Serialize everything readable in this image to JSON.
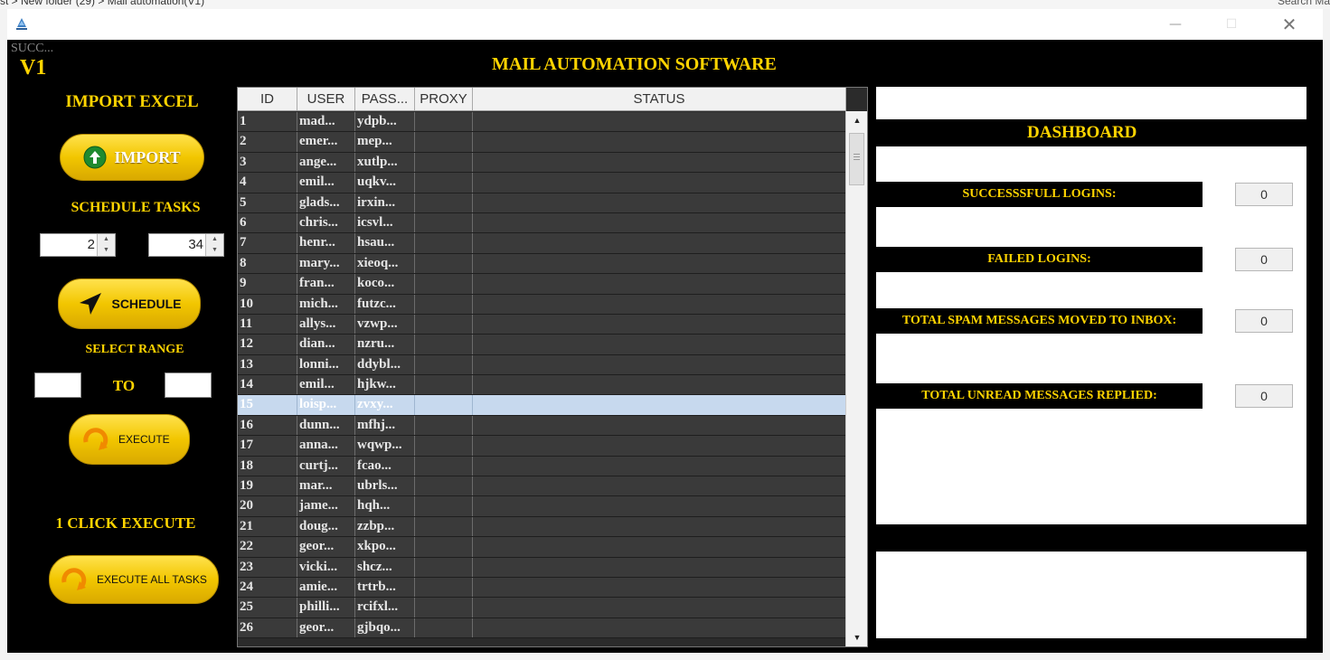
{
  "explorer": {
    "path": "st  >  New folder (29)  >  Mail automation(V1)",
    "search": "Search Ma"
  },
  "window": {
    "controls": {
      "minimize": "—",
      "maximize": "☐",
      "close": "✕"
    }
  },
  "app": {
    "status_text": "SUCC...",
    "version": "V1",
    "title": "MAIL AUTOMATION SOFTWARE"
  },
  "left_panel": {
    "import_heading": "IMPORT EXCEL",
    "import_button": "IMPORT",
    "schedule_heading": "SCHEDULE TASKS",
    "hour_value": "2",
    "minute_value": "34",
    "schedule_button": "SCHEDULE",
    "range_heading": "SELECT RANGE",
    "range_from": "",
    "range_to_label": "TO",
    "range_to": "",
    "execute_button": "EXECUTE",
    "one_click_heading": "1 CLICK EXECUTE",
    "execute_all_button": "EXECUTE ALL TASKS"
  },
  "table": {
    "columns": [
      "ID",
      "USER",
      "PASS...",
      "PROXY",
      "STATUS"
    ],
    "selected_row": 15,
    "rows": [
      {
        "id": "1",
        "user": "mad...",
        "pass": "ydpb...",
        "proxy": "",
        "status": ""
      },
      {
        "id": "2",
        "user": "emer...",
        "pass": "mep...",
        "proxy": "",
        "status": ""
      },
      {
        "id": "3",
        "user": "ange...",
        "pass": "xutlp...",
        "proxy": "",
        "status": ""
      },
      {
        "id": "4",
        "user": "emil...",
        "pass": "uqkv...",
        "proxy": "",
        "status": ""
      },
      {
        "id": "5",
        "user": "glads...",
        "pass": "irxin...",
        "proxy": "",
        "status": ""
      },
      {
        "id": "6",
        "user": "chris...",
        "pass": "icsvl...",
        "proxy": "",
        "status": ""
      },
      {
        "id": "7",
        "user": "henr...",
        "pass": "hsau...",
        "proxy": "",
        "status": ""
      },
      {
        "id": "8",
        "user": "mary...",
        "pass": "xieoq...",
        "proxy": "",
        "status": ""
      },
      {
        "id": "9",
        "user": "fran...",
        "pass": "koco...",
        "proxy": "",
        "status": ""
      },
      {
        "id": "10",
        "user": "mich...",
        "pass": "futzc...",
        "proxy": "",
        "status": ""
      },
      {
        "id": "11",
        "user": "allys...",
        "pass": "vzwp...",
        "proxy": "",
        "status": ""
      },
      {
        "id": "12",
        "user": "dian...",
        "pass": "nzru...",
        "proxy": "",
        "status": ""
      },
      {
        "id": "13",
        "user": "lonni...",
        "pass": "ddybl...",
        "proxy": "",
        "status": ""
      },
      {
        "id": "14",
        "user": "emil...",
        "pass": "hjkw...",
        "proxy": "",
        "status": ""
      },
      {
        "id": "15",
        "user": "loisp...",
        "pass": "zvxy...",
        "proxy": "",
        "status": ""
      },
      {
        "id": "16",
        "user": "dunn...",
        "pass": "mfhj...",
        "proxy": "",
        "status": ""
      },
      {
        "id": "17",
        "user": "anna...",
        "pass": "wqwp...",
        "proxy": "",
        "status": ""
      },
      {
        "id": "18",
        "user": "curtj...",
        "pass": "fcao...",
        "proxy": "",
        "status": ""
      },
      {
        "id": "19",
        "user": "mar...",
        "pass": "ubrls...",
        "proxy": "",
        "status": ""
      },
      {
        "id": "20",
        "user": "jame...",
        "pass": "hqh...",
        "proxy": "",
        "status": ""
      },
      {
        "id": "21",
        "user": "doug...",
        "pass": "zzbp...",
        "proxy": "",
        "status": ""
      },
      {
        "id": "22",
        "user": "geor...",
        "pass": "xkpo...",
        "proxy": "",
        "status": ""
      },
      {
        "id": "23",
        "user": "vicki...",
        "pass": "shcz...",
        "proxy": "",
        "status": ""
      },
      {
        "id": "24",
        "user": "amie...",
        "pass": "trtrb...",
        "proxy": "",
        "status": ""
      },
      {
        "id": "25",
        "user": "philli...",
        "pass": "rcifxl...",
        "proxy": "",
        "status": ""
      },
      {
        "id": "26",
        "user": "geor...",
        "pass": "gjbqo...",
        "proxy": "",
        "status": ""
      }
    ]
  },
  "dashboard": {
    "title": "DASHBOARD",
    "stats": [
      {
        "label": "SUCCESSSFULL LOGINS:",
        "value": "0"
      },
      {
        "label": "FAILED LOGINS:",
        "value": "0"
      },
      {
        "label": "TOTAL SPAM MESSAGES MOVED TO INBOX:",
        "value": "0"
      },
      {
        "label": "TOTAL UNREAD MESSAGES REPLIED:",
        "value": "0"
      }
    ]
  },
  "colors": {
    "accent": "#ffd400",
    "background": "#000000",
    "selection": "#c7d9ee",
    "button_yellow": "#f2c600"
  },
  "icons": {
    "import_button": "up-arrow-circle-icon",
    "schedule_button": "navigation-arrow-icon",
    "execute_button": "refresh-arrow-icon",
    "execute_all_button": "refresh-arrow-icon"
  }
}
